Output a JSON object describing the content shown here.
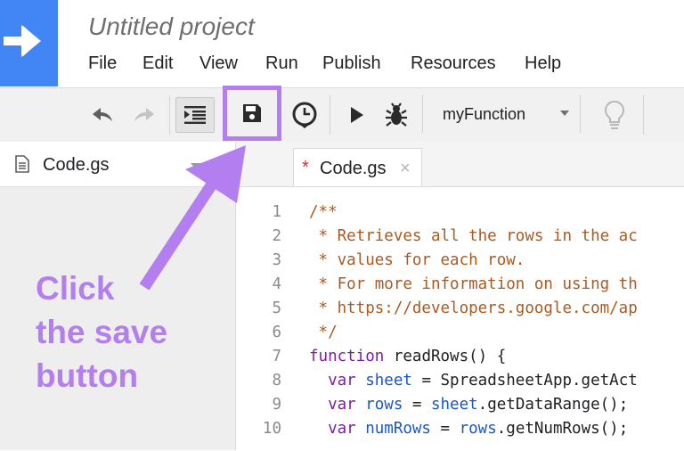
{
  "header": {
    "project_title": "Untitled project",
    "menu": [
      "File",
      "Edit",
      "View",
      "Run",
      "Publish",
      "Resources",
      "Help"
    ]
  },
  "toolbar": {
    "function_select": "myFunction",
    "icons": [
      "undo-icon",
      "redo-icon",
      "indent-icon",
      "save-icon",
      "triggers-icon",
      "run-icon",
      "debug-icon",
      "chevron-down-icon",
      "lightbulb-icon"
    ]
  },
  "sidebar": {
    "file_name": "Code.gs",
    "callout_lines": [
      "Click",
      "the save",
      "button"
    ]
  },
  "editor": {
    "tab_modified_marker": "*",
    "tab_label": "Code.gs",
    "tab_close": "×",
    "lines": [
      {
        "n": "1",
        "segs": [
          {
            "t": "/**",
            "c": "comment"
          }
        ]
      },
      {
        "n": "2",
        "segs": [
          {
            "t": " * Retrieves all the rows in the ac",
            "c": "comment"
          }
        ]
      },
      {
        "n": "3",
        "segs": [
          {
            "t": " * values for each row.",
            "c": "comment"
          }
        ]
      },
      {
        "n": "4",
        "segs": [
          {
            "t": " * For more information on using th",
            "c": "comment"
          }
        ]
      },
      {
        "n": "5",
        "segs": [
          {
            "t": " * https://developers.google.com/ap",
            "c": "comment"
          }
        ]
      },
      {
        "n": "6",
        "segs": [
          {
            "t": " */",
            "c": "comment"
          }
        ]
      },
      {
        "n": "7",
        "segs": [
          {
            "t": "function",
            "c": "kw"
          },
          {
            "t": " readRows() {",
            "c": "def"
          }
        ]
      },
      {
        "n": "8",
        "segs": [
          {
            "t": "  var ",
            "c": "kw"
          },
          {
            "t": "sheet",
            "c": "var"
          },
          {
            "t": " = SpreadsheetApp.getAct",
            "c": "def"
          }
        ]
      },
      {
        "n": "9",
        "segs": [
          {
            "t": "  var ",
            "c": "kw"
          },
          {
            "t": "rows",
            "c": "var"
          },
          {
            "t": " = ",
            "c": "def"
          },
          {
            "t": "sheet",
            "c": "var"
          },
          {
            "t": ".getDataRange();",
            "c": "def"
          }
        ]
      },
      {
        "n": "10",
        "segs": [
          {
            "t": "  var ",
            "c": "kw"
          },
          {
            "t": "numRows",
            "c": "var"
          },
          {
            "t": " = ",
            "c": "def"
          },
          {
            "t": "rows",
            "c": "var"
          },
          {
            "t": ".getNumRows();",
            "c": "def"
          }
        ]
      }
    ]
  },
  "colors": {
    "brand": "#4285f4",
    "highlight": "#b37ff0",
    "comment": "#a95a20",
    "keyword": "#7a1fa2",
    "variable": "#1a56c8"
  }
}
